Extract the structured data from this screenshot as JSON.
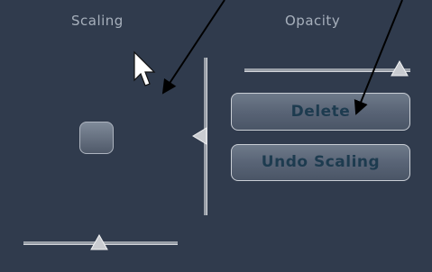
{
  "sections": {
    "scaling_title": "Scaling",
    "opacity_title": "Opacity"
  },
  "buttons": {
    "delete_label": "Delete",
    "undo_scaling_label": "Undo Scaling"
  },
  "sliders": {
    "opacity_level": 0.9,
    "scaling_horizontal_level": 0.5,
    "scaling_vertical_level": 0.5
  },
  "colors": {
    "panel_background": "#303b4d",
    "title_text": "#a7b0bc",
    "button_text": "#1d3b4f"
  },
  "icons": {
    "cursor": "mouse-pointer-icon",
    "arrow": "annotation-arrow-icon"
  }
}
